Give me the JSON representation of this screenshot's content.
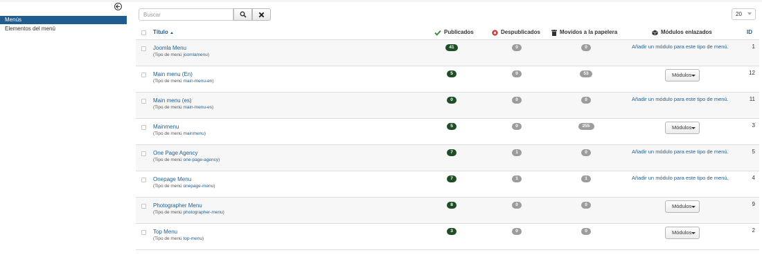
{
  "sidebar": {
    "items": [
      {
        "label": "Menús"
      },
      {
        "label": "Elementos del menú"
      }
    ]
  },
  "toolbar": {
    "search_placeholder": "Buscar",
    "limit_value": "20"
  },
  "table": {
    "headers": {
      "title": "Título",
      "published": "Publicados",
      "unpublished": "Despublicados",
      "trashed": "Movidos a la papelera",
      "modules": "Módulos enlazados",
      "id": "ID"
    },
    "subtitle_prefix": "(Tipo de menú",
    "rows": [
      {
        "title": "Joomla Menu",
        "menutype": "joomlamenu",
        "published": "41",
        "unpublished": "0",
        "trashed": "0",
        "module_action": "link",
        "module_text": "Añadir un módulo para este tipo de menú.",
        "id": "1"
      },
      {
        "title": "Main menu (En)",
        "menutype": "main-menu-en",
        "published": "5",
        "unpublished": "0",
        "trashed": "53",
        "module_action": "button",
        "module_text": "Módulos",
        "id": "12"
      },
      {
        "title": "Main menu (es)",
        "menutype": "main-menu-es",
        "published": "0",
        "unpublished": "0",
        "trashed": "0",
        "module_action": "link",
        "module_text": "Añadir un módulo para este tipo de menú.",
        "id": "11"
      },
      {
        "title": "Mainmenu",
        "menutype": "mainmenu",
        "published": "5",
        "unpublished": "0",
        "trashed": "255",
        "module_action": "button",
        "module_text": "Módulos",
        "id": "3"
      },
      {
        "title": "One Page Agency",
        "menutype": "one-page-agency",
        "published": "7",
        "unpublished": "1",
        "trashed": "0",
        "module_action": "link",
        "module_text": "Añadir un módulo para este tipo de menú.",
        "id": "5"
      },
      {
        "title": "Onepage Menu",
        "menutype": "onepage-menu",
        "published": "7",
        "unpublished": "1",
        "trashed": "1",
        "module_action": "link",
        "module_text": "Añadir un módulo para este tipo de menú.",
        "id": "4"
      },
      {
        "title": "Photographer Menu",
        "menutype": "photographer-menu",
        "published": "8",
        "unpublished": "0",
        "trashed": "0",
        "module_action": "button",
        "module_text": "Módulos",
        "id": "9"
      },
      {
        "title": "Top Menu",
        "menutype": "top-menu",
        "published": "3",
        "unpublished": "0",
        "trashed": "0",
        "module_action": "button",
        "module_text": "Módulos",
        "id": "2"
      }
    ]
  },
  "colors": {
    "accent": "#1f5c8f",
    "published_badge": "#1e4d26",
    "neutral_badge": "#9c9c9c",
    "published_icon": "#3c8b3c",
    "unpublished_icon": "#bd362f"
  }
}
